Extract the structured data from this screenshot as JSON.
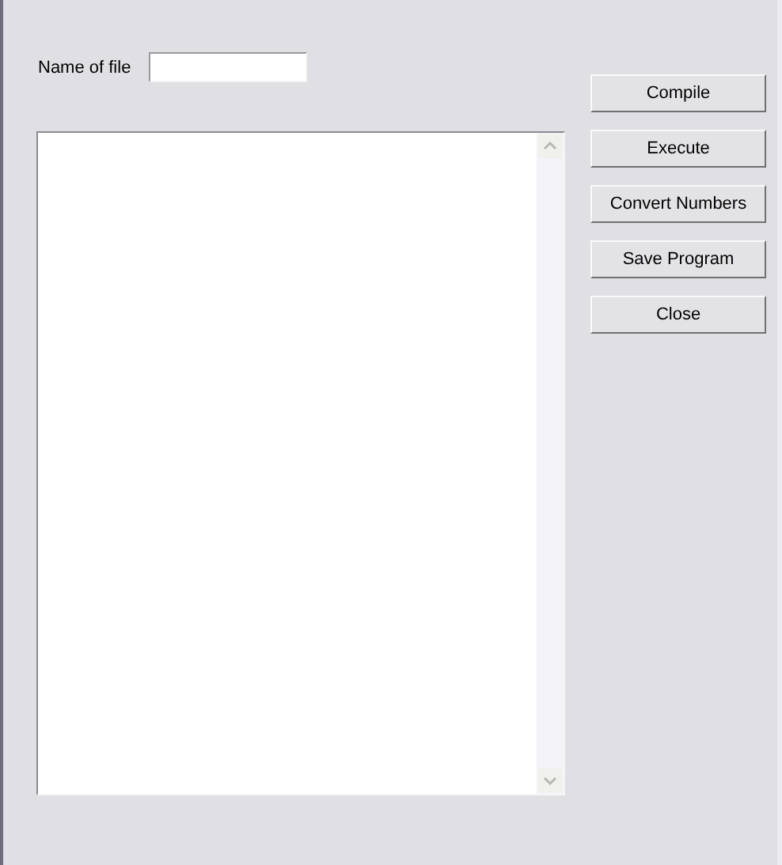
{
  "file_name": {
    "label": "Name of file"
  },
  "buttons": [
    {
      "label": "Compile"
    },
    {
      "label": "Execute"
    },
    {
      "label": "Convert Numbers"
    },
    {
      "label": "Save Program"
    },
    {
      "label": "Close"
    }
  ]
}
